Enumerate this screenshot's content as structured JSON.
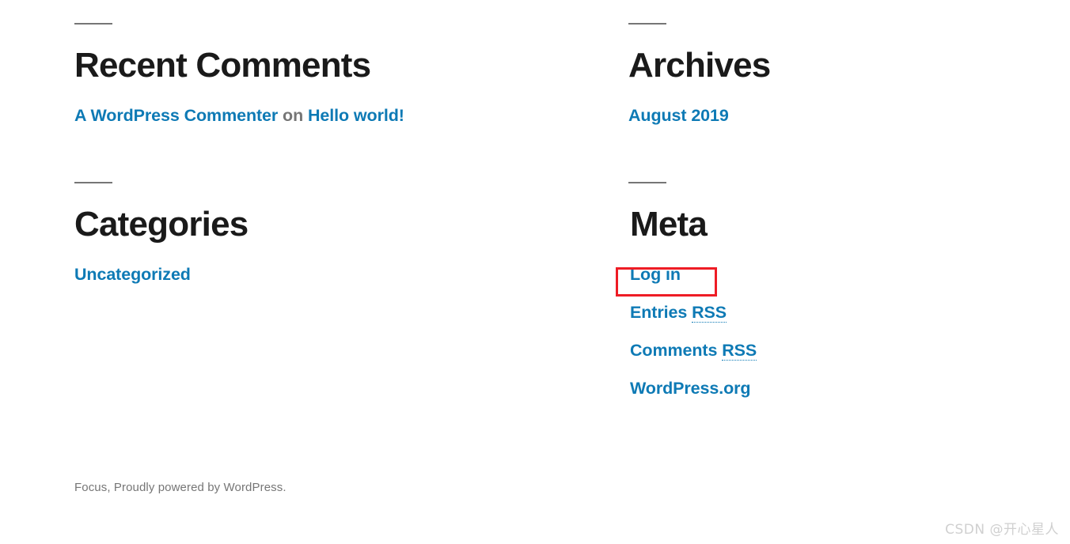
{
  "page": {
    "background": "#ffffff",
    "link_color": "#0e7ab5",
    "muted_color": "#767676",
    "heading_color": "#1a1a1a",
    "highlight_color": "#ee1c25"
  },
  "widgets": {
    "recent_comments": {
      "title": "Recent Comments",
      "items": [
        {
          "author": "A WordPress Commenter",
          "separator": "on",
          "post": "Hello world!"
        }
      ]
    },
    "categories": {
      "title": "Categories",
      "items": [
        {
          "label": "Uncategorized"
        }
      ]
    },
    "archives": {
      "title": "Archives",
      "items": [
        {
          "label": "August 2019"
        }
      ]
    },
    "meta": {
      "title": "Meta",
      "items": [
        {
          "label": "Log in",
          "highlighted": true
        },
        {
          "prefix": "Entries ",
          "abbr": "RSS"
        },
        {
          "prefix": "Comments ",
          "abbr": "RSS"
        },
        {
          "label": "WordPress.org"
        }
      ]
    }
  },
  "footer": {
    "theme_credit": "Focus, Proudly powered by ",
    "platform_link": "WordPress",
    "period": "."
  },
  "watermark": {
    "text": "CSDN @开心星人"
  }
}
